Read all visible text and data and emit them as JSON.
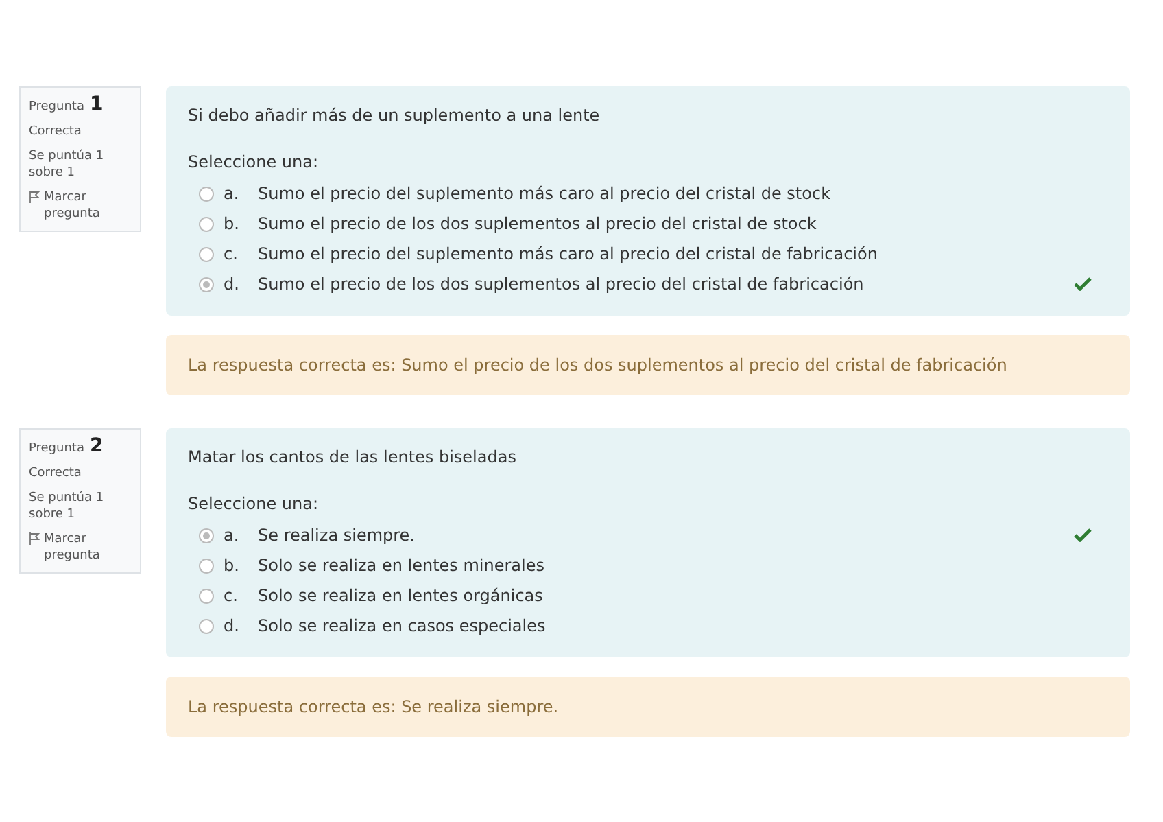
{
  "questions": [
    {
      "label": "Pregunta",
      "number": "1",
      "state": "Correcta",
      "grade": "Se puntúa 1 sobre 1",
      "flag": "Marcar pregunta",
      "text": "Si debo añadir más de un suplemento a una lente",
      "prompt": "Seleccione una:",
      "options": [
        {
          "letter": "a.",
          "text": "Sumo el precio del suplemento más caro al precio del cristal de stock",
          "selected": false,
          "correct": false
        },
        {
          "letter": "b.",
          "text": "Sumo el precio de los dos suplementos al precio del cristal de stock",
          "selected": false,
          "correct": false
        },
        {
          "letter": "c.",
          "text": "Sumo el precio del suplemento más caro al precio del cristal de fabricación",
          "selected": false,
          "correct": false
        },
        {
          "letter": "d.",
          "text": "Sumo el precio de los dos suplementos al precio del cristal de fabricación",
          "selected": true,
          "correct": true
        }
      ],
      "feedback": "La respuesta correcta es: Sumo el precio de los dos suplementos al precio del cristal de fabricación"
    },
    {
      "label": "Pregunta",
      "number": "2",
      "state": "Correcta",
      "grade": "Se puntúa 1 sobre 1",
      "flag": "Marcar pregunta",
      "text": "Matar los cantos de las lentes biseladas",
      "prompt": "Seleccione una:",
      "options": [
        {
          "letter": "a.",
          "text": "Se realiza siempre.",
          "selected": true,
          "correct": true
        },
        {
          "letter": "b.",
          "text": "Solo se realiza en lentes minerales",
          "selected": false,
          "correct": false
        },
        {
          "letter": "c.",
          "text": "Solo se realiza en lentes orgánicas",
          "selected": false,
          "correct": false
        },
        {
          "letter": "d.",
          "text": "Solo se realiza en casos especiales",
          "selected": false,
          "correct": false
        }
      ],
      "feedback": "La respuesta correcta es: Se realiza siempre."
    }
  ]
}
